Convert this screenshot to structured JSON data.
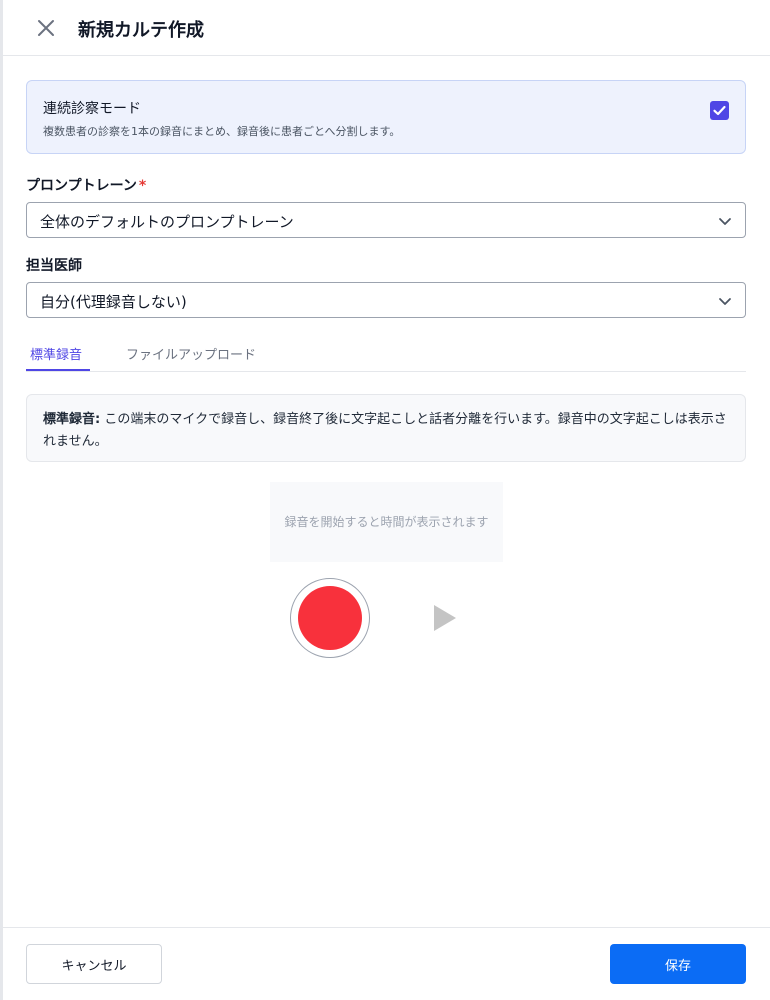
{
  "header": {
    "title": "新規カルテ作成",
    "close_icon": "close-icon"
  },
  "continuous_mode": {
    "title": "連続診察モード",
    "description": "複数患者の診察を1本の録音にまとめ、録音後に患者ごとへ分割します。",
    "checked": true
  },
  "prompt_field": {
    "label": "プロンプトレーン",
    "required_mark": "*",
    "value": "全体のデフォルトのプロンプトレーン"
  },
  "doctor_field": {
    "label": "担当医師",
    "value": "自分(代理録音しない)"
  },
  "tabs": [
    {
      "label": "標準録音",
      "active": true
    },
    {
      "label": "ファイルアップロード",
      "active": false
    }
  ],
  "info": {
    "strong": "標準録音:",
    "text": " この端末のマイクで録音し、録音終了後に文字起こしと話者分離を行います。録音中の文字起こしは表示されません。"
  },
  "recorder": {
    "timer_placeholder": "録音を開始すると時間が表示されます",
    "record_icon": "record-icon",
    "play_icon": "play-icon"
  },
  "footer": {
    "cancel_label": "キャンセル",
    "save_label": "保存"
  },
  "colors": {
    "accent": "#4f46e5",
    "primary_button": "#0b6cf5",
    "record": "#f8313c",
    "mode_card_bg": "#eef2fd"
  }
}
